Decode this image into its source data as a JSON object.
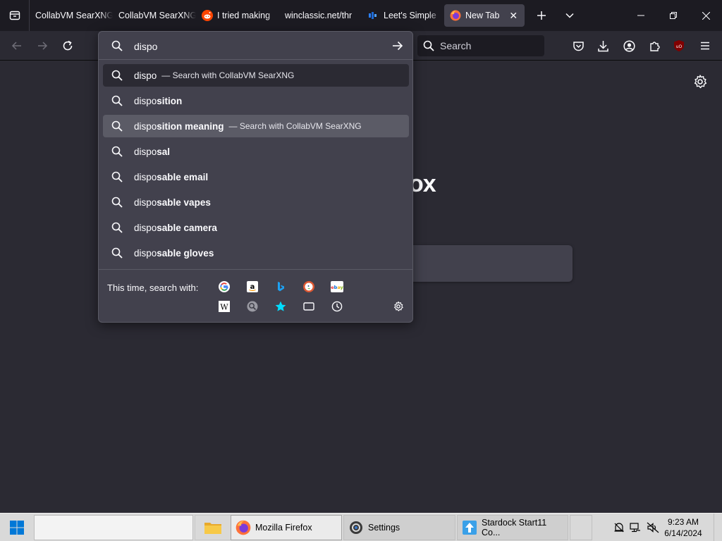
{
  "tabs": [
    {
      "title": "CollabVM SearXNG",
      "icon": "none"
    },
    {
      "title": "CollabVM SearXNG",
      "icon": "none"
    },
    {
      "title": "I tried making",
      "icon": "reddit-icon"
    },
    {
      "title": "winclassic.net/thr",
      "icon": "none"
    },
    {
      "title": "Leet's Simple",
      "icon": "leet-icon"
    },
    {
      "title": "New Tab",
      "icon": "firefox-icon",
      "active": true
    }
  ],
  "navbar": {
    "search_placeholder": "Search"
  },
  "urlbar": {
    "typed": "dispo",
    "results": [
      {
        "prefix": "dispo",
        "completion": "",
        "action": "— Search with CollabVM SearXNG",
        "state": "selected"
      },
      {
        "prefix": "dispo",
        "completion": "sition",
        "action": "",
        "state": "normal"
      },
      {
        "prefix": "dispo",
        "completion": "sition meaning",
        "action": "— Search with CollabVM SearXNG",
        "state": "hover"
      },
      {
        "prefix": "dispo",
        "completion": "sal",
        "action": "",
        "state": "normal"
      },
      {
        "prefix": "dispo",
        "completion": "sable email",
        "action": "",
        "state": "normal"
      },
      {
        "prefix": "dispo",
        "completion": "sable vapes",
        "action": "",
        "state": "normal"
      },
      {
        "prefix": "dispo",
        "completion": "sable camera",
        "action": "",
        "state": "normal"
      },
      {
        "prefix": "dispo",
        "completion": "sable gloves",
        "action": "",
        "state": "normal"
      }
    ],
    "oneoff_label": "This time, search with:",
    "engines_row1": [
      "google-icon",
      "amazon-icon",
      "bing-icon",
      "duckduckgo-icon",
      "ebay-icon"
    ],
    "engines_row2": [
      "wikipedia-icon",
      "searxng-icon",
      "bookmarks-icon",
      "tabs-icon",
      "history-icon"
    ]
  },
  "newtab": {
    "brand_visible_text": "ox"
  },
  "taskbar": {
    "items": [
      {
        "label": "",
        "icon": "file-explorer-icon"
      },
      {
        "label": "Mozilla Firefox",
        "icon": "firefox-icon"
      },
      {
        "label": "Settings",
        "icon": "settings-gear-icon"
      },
      {
        "label": "Stardock Start11 Co...",
        "icon": "start11-icon"
      }
    ],
    "time": "9:23 AM",
    "date": "6/14/2024"
  },
  "colors": {
    "accent": "#00ddff",
    "panel": "#42414d",
    "toolbar": "#2b2a33",
    "tabstrip": "#1c1b22"
  }
}
